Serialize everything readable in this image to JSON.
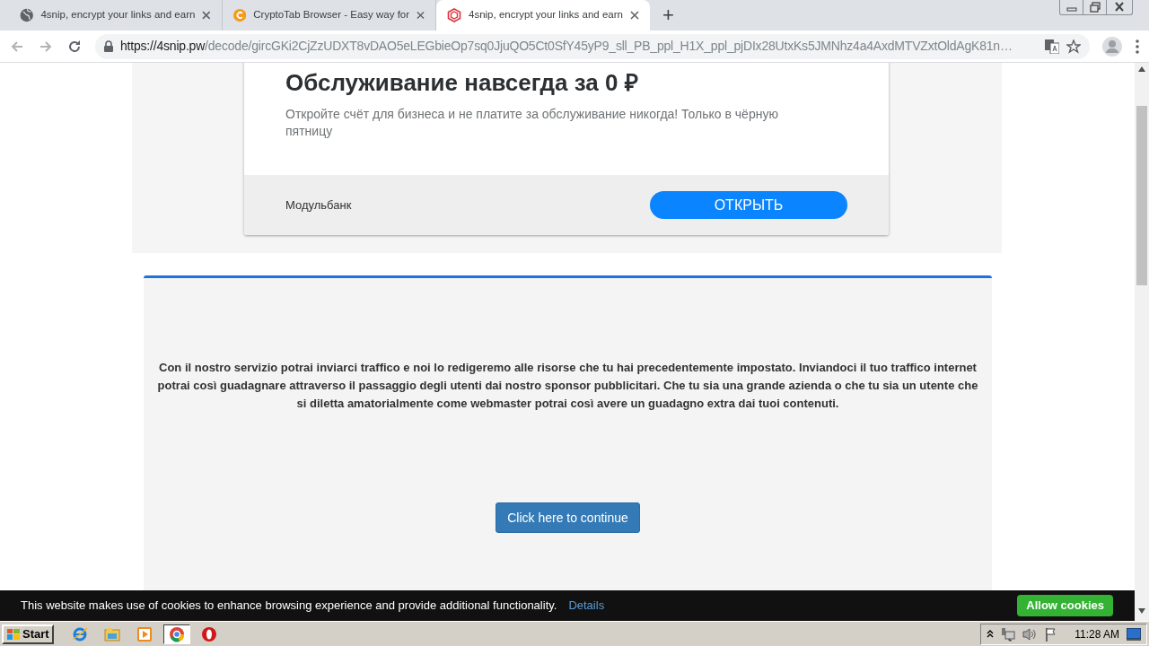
{
  "browser": {
    "tabs": [
      {
        "title": "4snip, encrypt your links and earn",
        "kind": "globe",
        "selected": false
      },
      {
        "title": "CryptoTab Browser - Easy way for",
        "kind": "cryptotab",
        "selected": false
      },
      {
        "title": "4snip, encrypt your links and earn",
        "kind": "snip",
        "selected": true
      }
    ],
    "new_tab": "+",
    "address_bar": {
      "url_host": "https://4snip.pw",
      "url_path": "/decode/gircGKi2CjZzUDXT8vDAO5eLEGbieOp7sq0JjuQO5Ct0SfY45yP9_sll_PB_ppl_H1X_ppl_pjDIx28UtxKs5JMNhz4a4AxdMTVZxtOldAgK81n…"
    }
  },
  "ad": {
    "title": "Обслуживание навсегда за 0 ₽",
    "text": "Откройте счёт для бизнеса и не платите за обслуживание никогда! Только в чёрную пятницу",
    "advertiser": "Модульбанк",
    "button": "ОТКРЫТЬ"
  },
  "panel": {
    "text": "Con il nostro servizio potrai inviarci traffico e noi lo redigeremo alle risorse che tu hai precedentemente impostato. Inviandoci il tuo traffico internet potrai così guadagnare attraverso il passaggio degli utenti dai nostro sponsor pubblicitari. Che tu sia una grande azienda o che tu sia un utente che si diletta amatorialmente come webmaster potrai così avere un guadagno extra dai tuoi contenuti.",
    "button": "Click here to continue"
  },
  "cookie_bar": {
    "text": "This website makes use of cookies to enhance browsing experience and provide additional functionality.",
    "link": "Details",
    "button": "Allow cookies"
  },
  "taskbar": {
    "start": "Start",
    "apps": [
      {
        "kind": "ie",
        "selected": false
      },
      {
        "kind": "explorer",
        "selected": false
      },
      {
        "kind": "media",
        "selected": false
      },
      {
        "kind": "chrome",
        "selected": true
      },
      {
        "kind": "opera",
        "selected": false
      }
    ],
    "clock": "11:28 AM"
  }
}
